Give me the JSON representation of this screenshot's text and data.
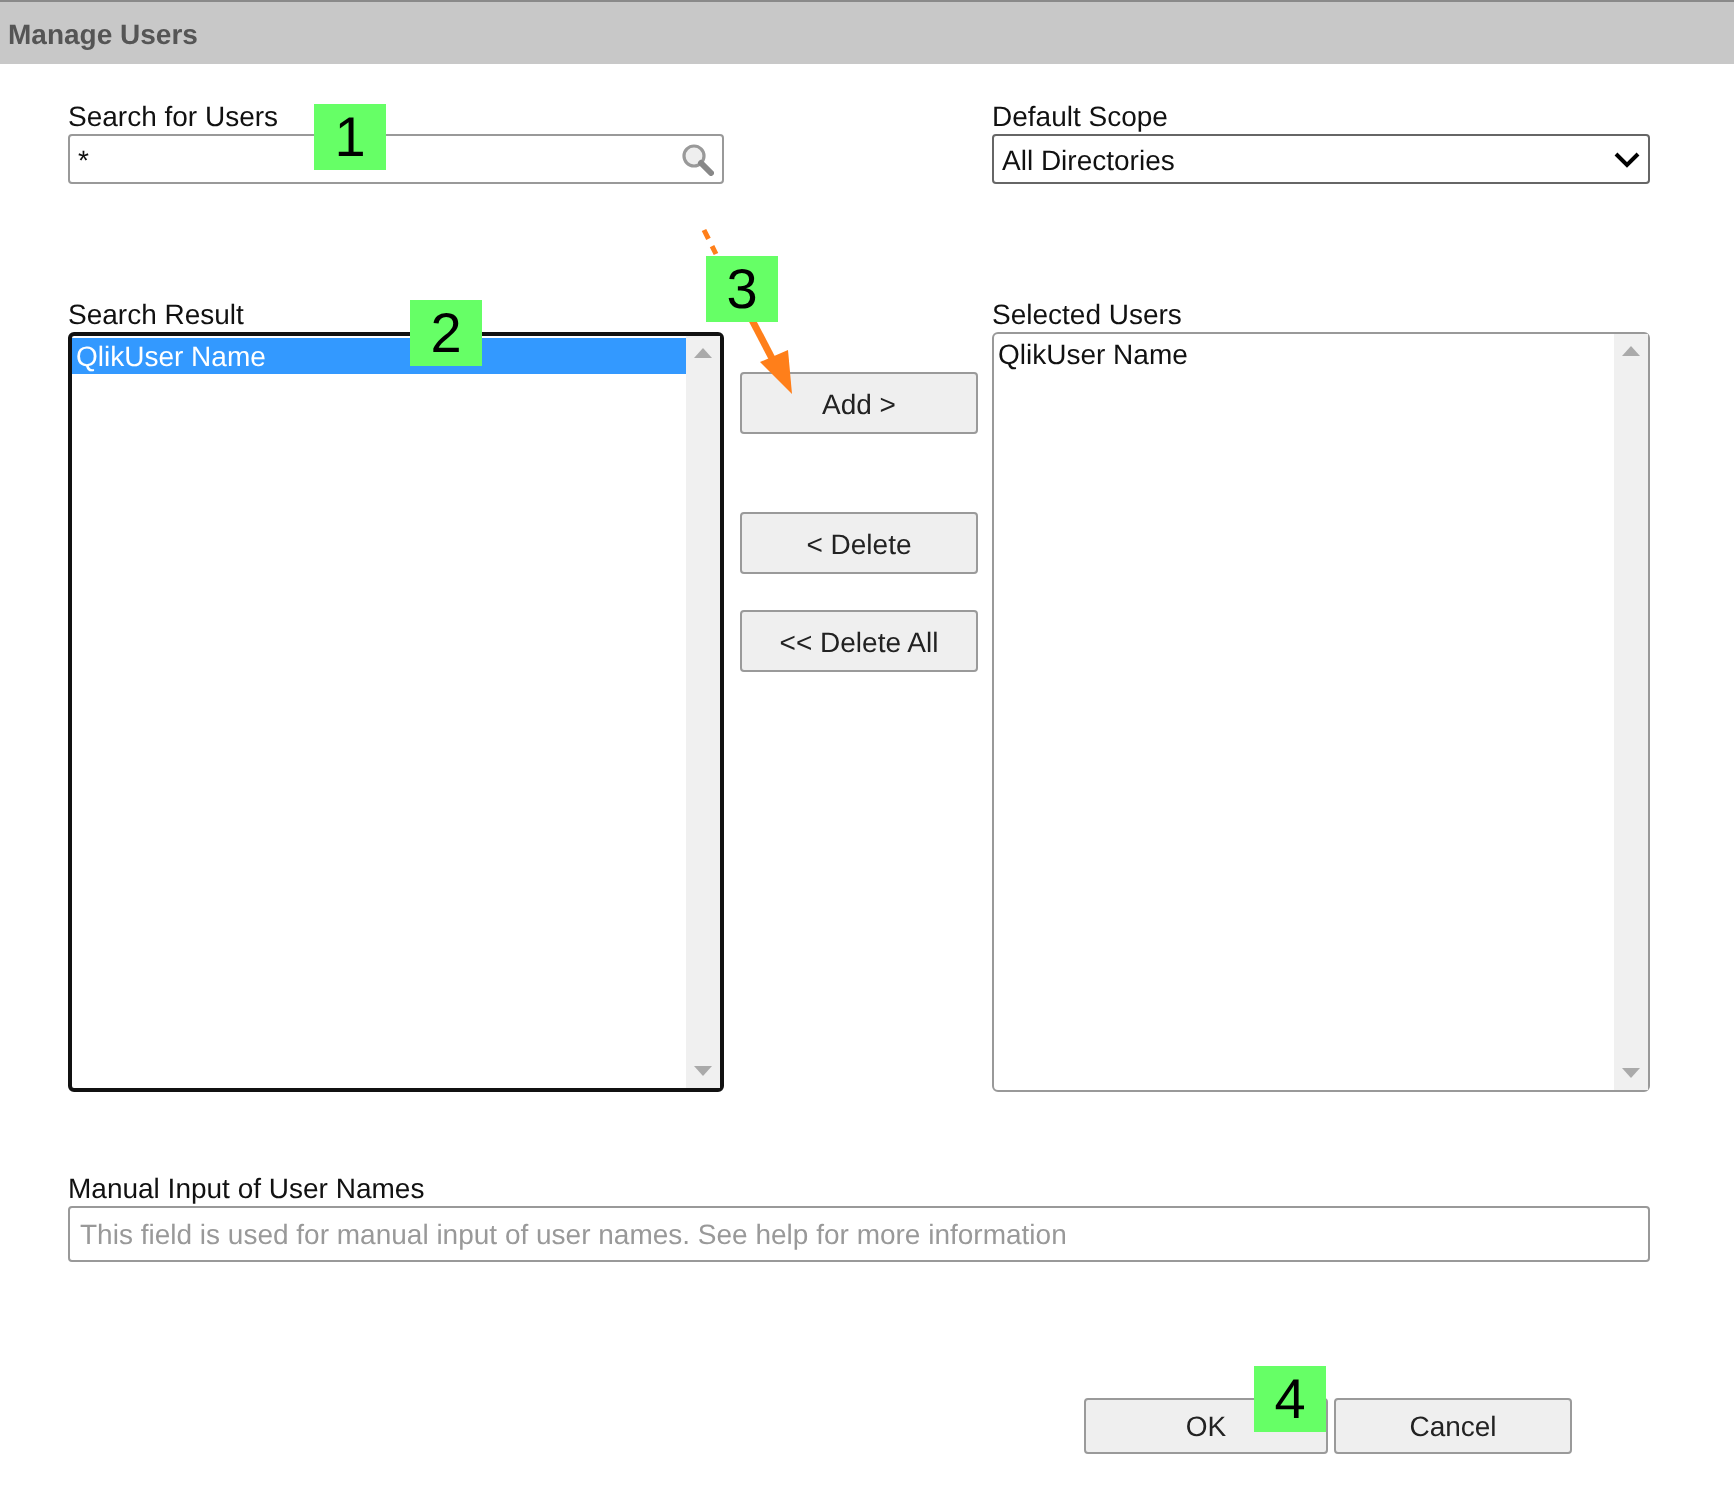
{
  "window": {
    "title": "Manage Users"
  },
  "search": {
    "label": "Search for Users",
    "value": "*"
  },
  "scope": {
    "label": "Default Scope",
    "value": "All Directories"
  },
  "search_result": {
    "label": "Search Result",
    "focused": true,
    "items": [
      {
        "name": "QlikUser Name",
        "selected": true
      }
    ]
  },
  "actions": [
    "Add >",
    "< Delete",
    "<< Delete All"
  ],
  "selected_users": {
    "label": "Selected Users",
    "items": [
      {
        "name": "QlikUser Name",
        "selected": false
      }
    ]
  },
  "manual_input": {
    "label": "Manual Input of User Names",
    "placeholder": "This field is used for manual input of user names. See help for more information"
  },
  "buttons": [
    "OK",
    "Cancel"
  ],
  "callouts": [
    "1",
    "2",
    "3",
    "4"
  ]
}
